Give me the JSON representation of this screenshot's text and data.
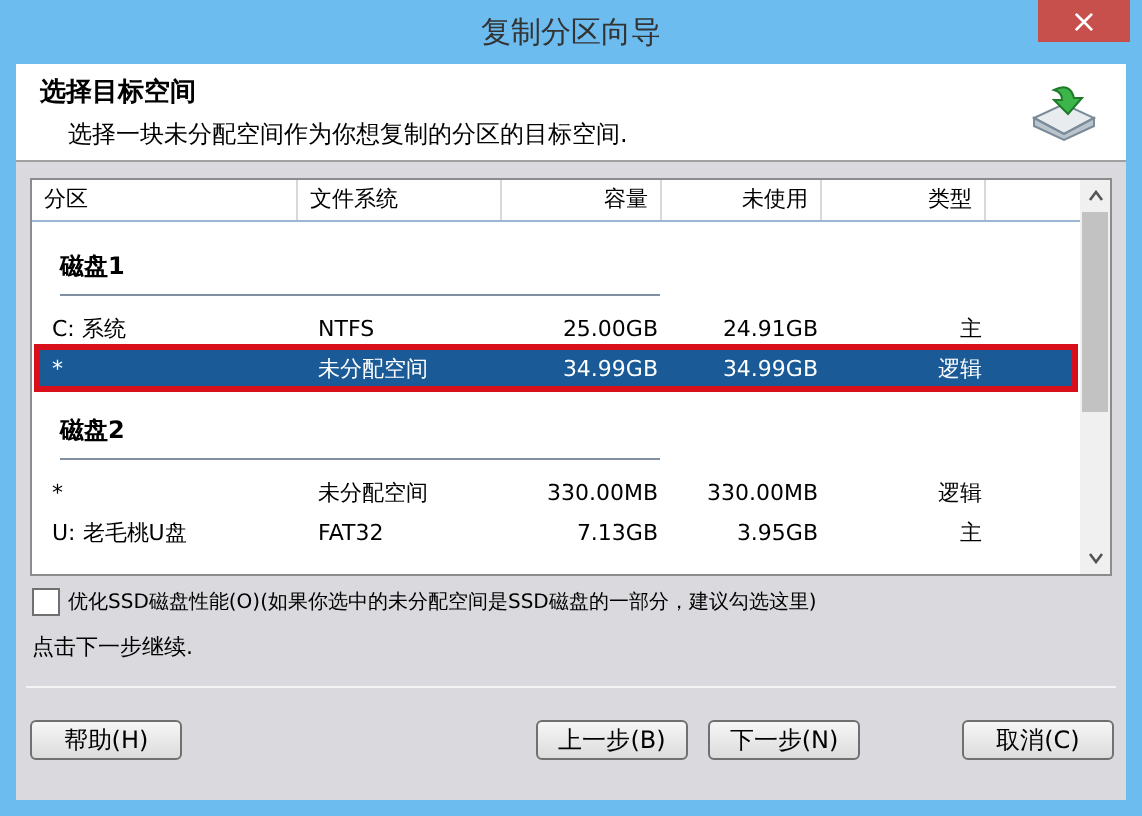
{
  "window": {
    "title": "复制分区向导",
    "close": "×"
  },
  "header": {
    "title": "选择目标空间",
    "subtitle": "选择一块未分配空间作为你想复制的分区的目标空间."
  },
  "table": {
    "columns": [
      {
        "label": "分区"
      },
      {
        "label": "文件系统"
      },
      {
        "label": "容量"
      },
      {
        "label": "未使用"
      },
      {
        "label": "类型"
      }
    ],
    "disks": [
      {
        "name": "磁盘1",
        "rows": [
          {
            "cells": [
              "C:  系统",
              "NTFS",
              "25.00GB",
              "24.91GB",
              "主"
            ],
            "selected": false
          },
          {
            "cells": [
              "*",
              "未分配空间",
              "34.99GB",
              "34.99GB",
              "逻辑"
            ],
            "selected": true
          }
        ]
      },
      {
        "name": "磁盘2",
        "rows": [
          {
            "cells": [
              "*",
              "未分配空间",
              "330.00MB",
              "330.00MB",
              "逻辑"
            ],
            "selected": false
          },
          {
            "cells": [
              "U:  老毛桃U盘",
              "FAT32",
              "7.13GB",
              "3.95GB",
              "主"
            ],
            "selected": false
          }
        ]
      }
    ]
  },
  "ssd_option": {
    "label": "优化SSD磁盘性能(O)(如果你选中的未分配空间是SSD磁盘的一部分，建议勾选这里)",
    "checked": false
  },
  "hint": "点击下一步继续.",
  "buttons": {
    "help": "帮助(H)",
    "back": "上一步(B)",
    "next": "下一步(N)",
    "cancel": "取消(C)"
  }
}
